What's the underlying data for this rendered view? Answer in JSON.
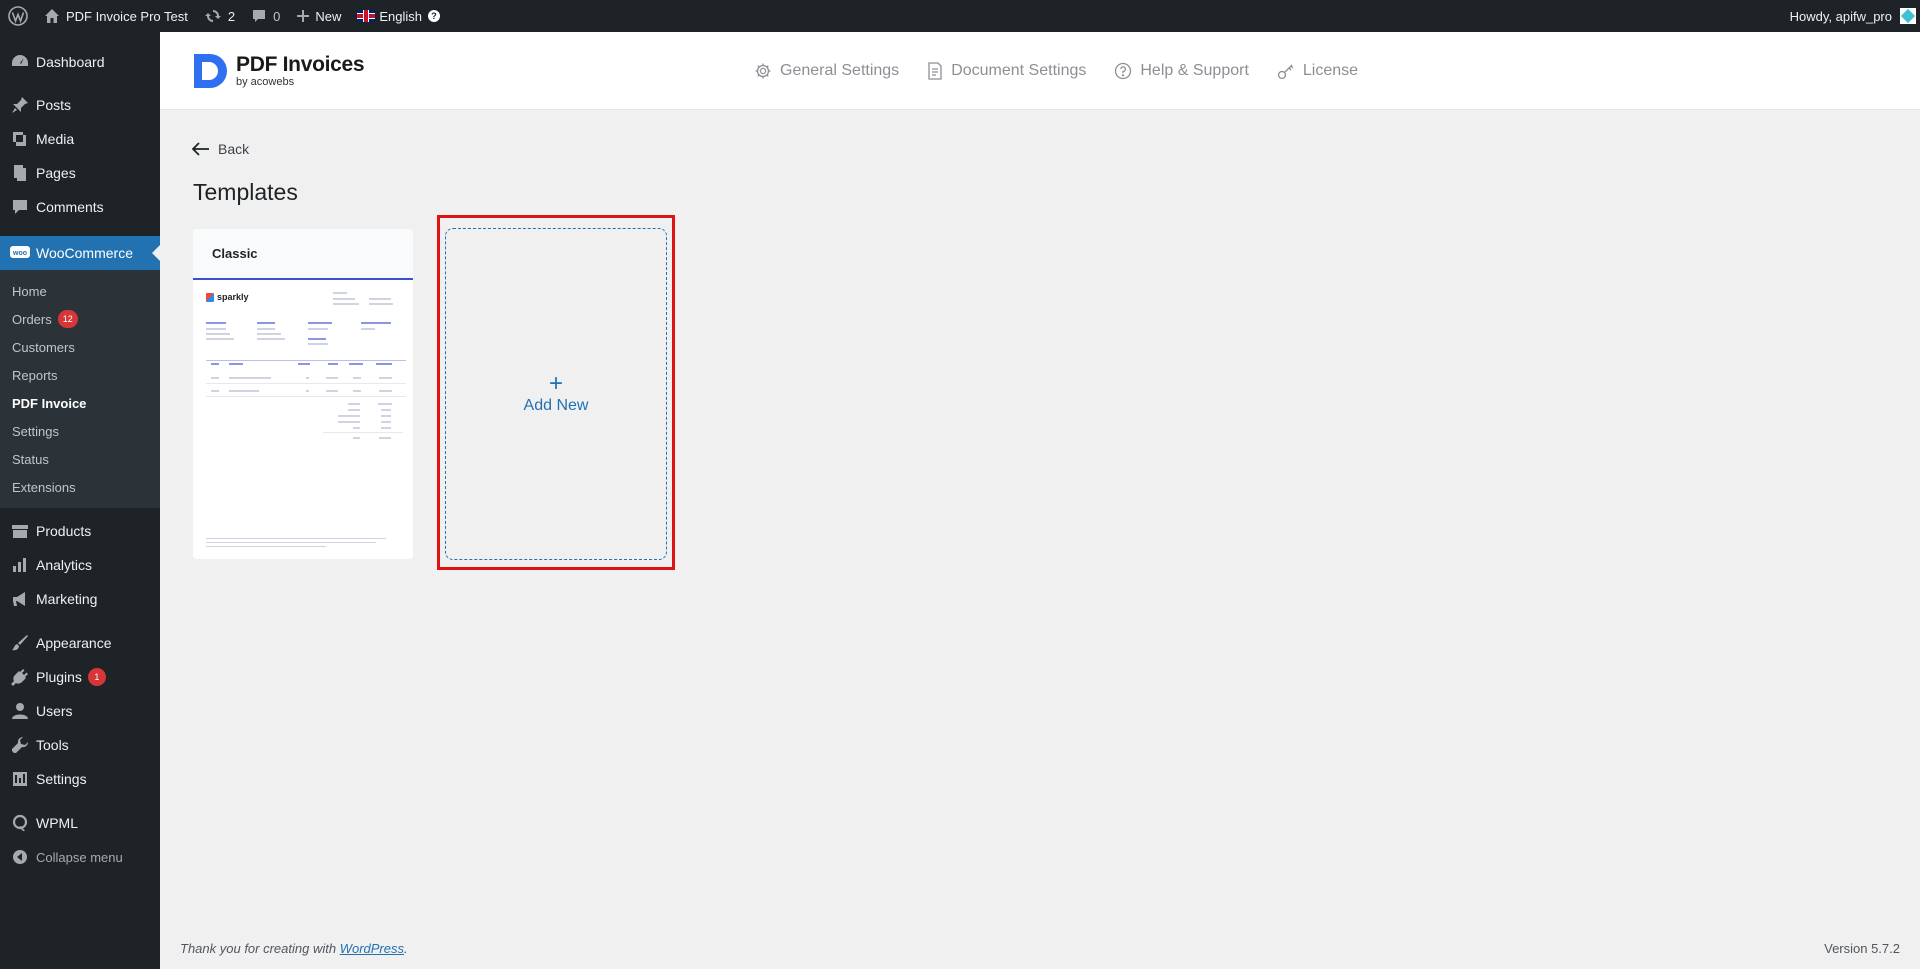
{
  "admin_bar": {
    "site_name": "PDF Invoice Pro Test",
    "updates_count": "2",
    "comments_count": "0",
    "new_label": "New",
    "language_label": "English",
    "howdy": "Howdy, apifw_pro"
  },
  "sidebar": {
    "items": [
      {
        "label": "Dashboard",
        "icon": "dashboard-icon"
      },
      {
        "label": "Posts",
        "icon": "pin-icon"
      },
      {
        "label": "Media",
        "icon": "media-icon"
      },
      {
        "label": "Pages",
        "icon": "pages-icon"
      },
      {
        "label": "Comments",
        "icon": "comment-icon"
      },
      {
        "label": "WooCommerce",
        "icon": "woo-icon"
      }
    ],
    "woo_submenu": [
      "Home",
      "Orders",
      "Customers",
      "Reports",
      "PDF Invoice",
      "Settings",
      "Status",
      "Extensions"
    ],
    "orders_badge": "12",
    "items2": [
      {
        "label": "Products",
        "icon": "products-icon"
      },
      {
        "label": "Analytics",
        "icon": "analytics-icon"
      },
      {
        "label": "Marketing",
        "icon": "megaphone-icon"
      },
      {
        "label": "Appearance",
        "icon": "brush-icon"
      },
      {
        "label": "Plugins",
        "icon": "plug-icon"
      },
      {
        "label": "Users",
        "icon": "user-icon"
      },
      {
        "label": "Tools",
        "icon": "wrench-icon"
      },
      {
        "label": "Settings",
        "icon": "settings-icon"
      },
      {
        "label": "WPML",
        "icon": "wpml-icon"
      }
    ],
    "plugins_badge": "1",
    "collapse_label": "Collapse menu"
  },
  "header": {
    "logo_title": "PDF Invoices",
    "logo_sub": "by acowebs",
    "nav": [
      "General Settings",
      "Document Settings",
      "Help & Support",
      "License"
    ]
  },
  "main": {
    "back_label": "Back",
    "title": "Templates",
    "template_name": "Classic",
    "template_preview_logo": "sparkly",
    "add_new_label": "Add New"
  },
  "footer": {
    "thanks_prefix": "Thank you for creating with",
    "wordpress_link": "WordPress",
    "thanks_suffix": ".",
    "version": "Version 5.7.2"
  },
  "colors": {
    "admin_dark": "#1d2327",
    "accent": "#2271b1",
    "highlight": "#e01313",
    "background": "#f0f0f1"
  }
}
